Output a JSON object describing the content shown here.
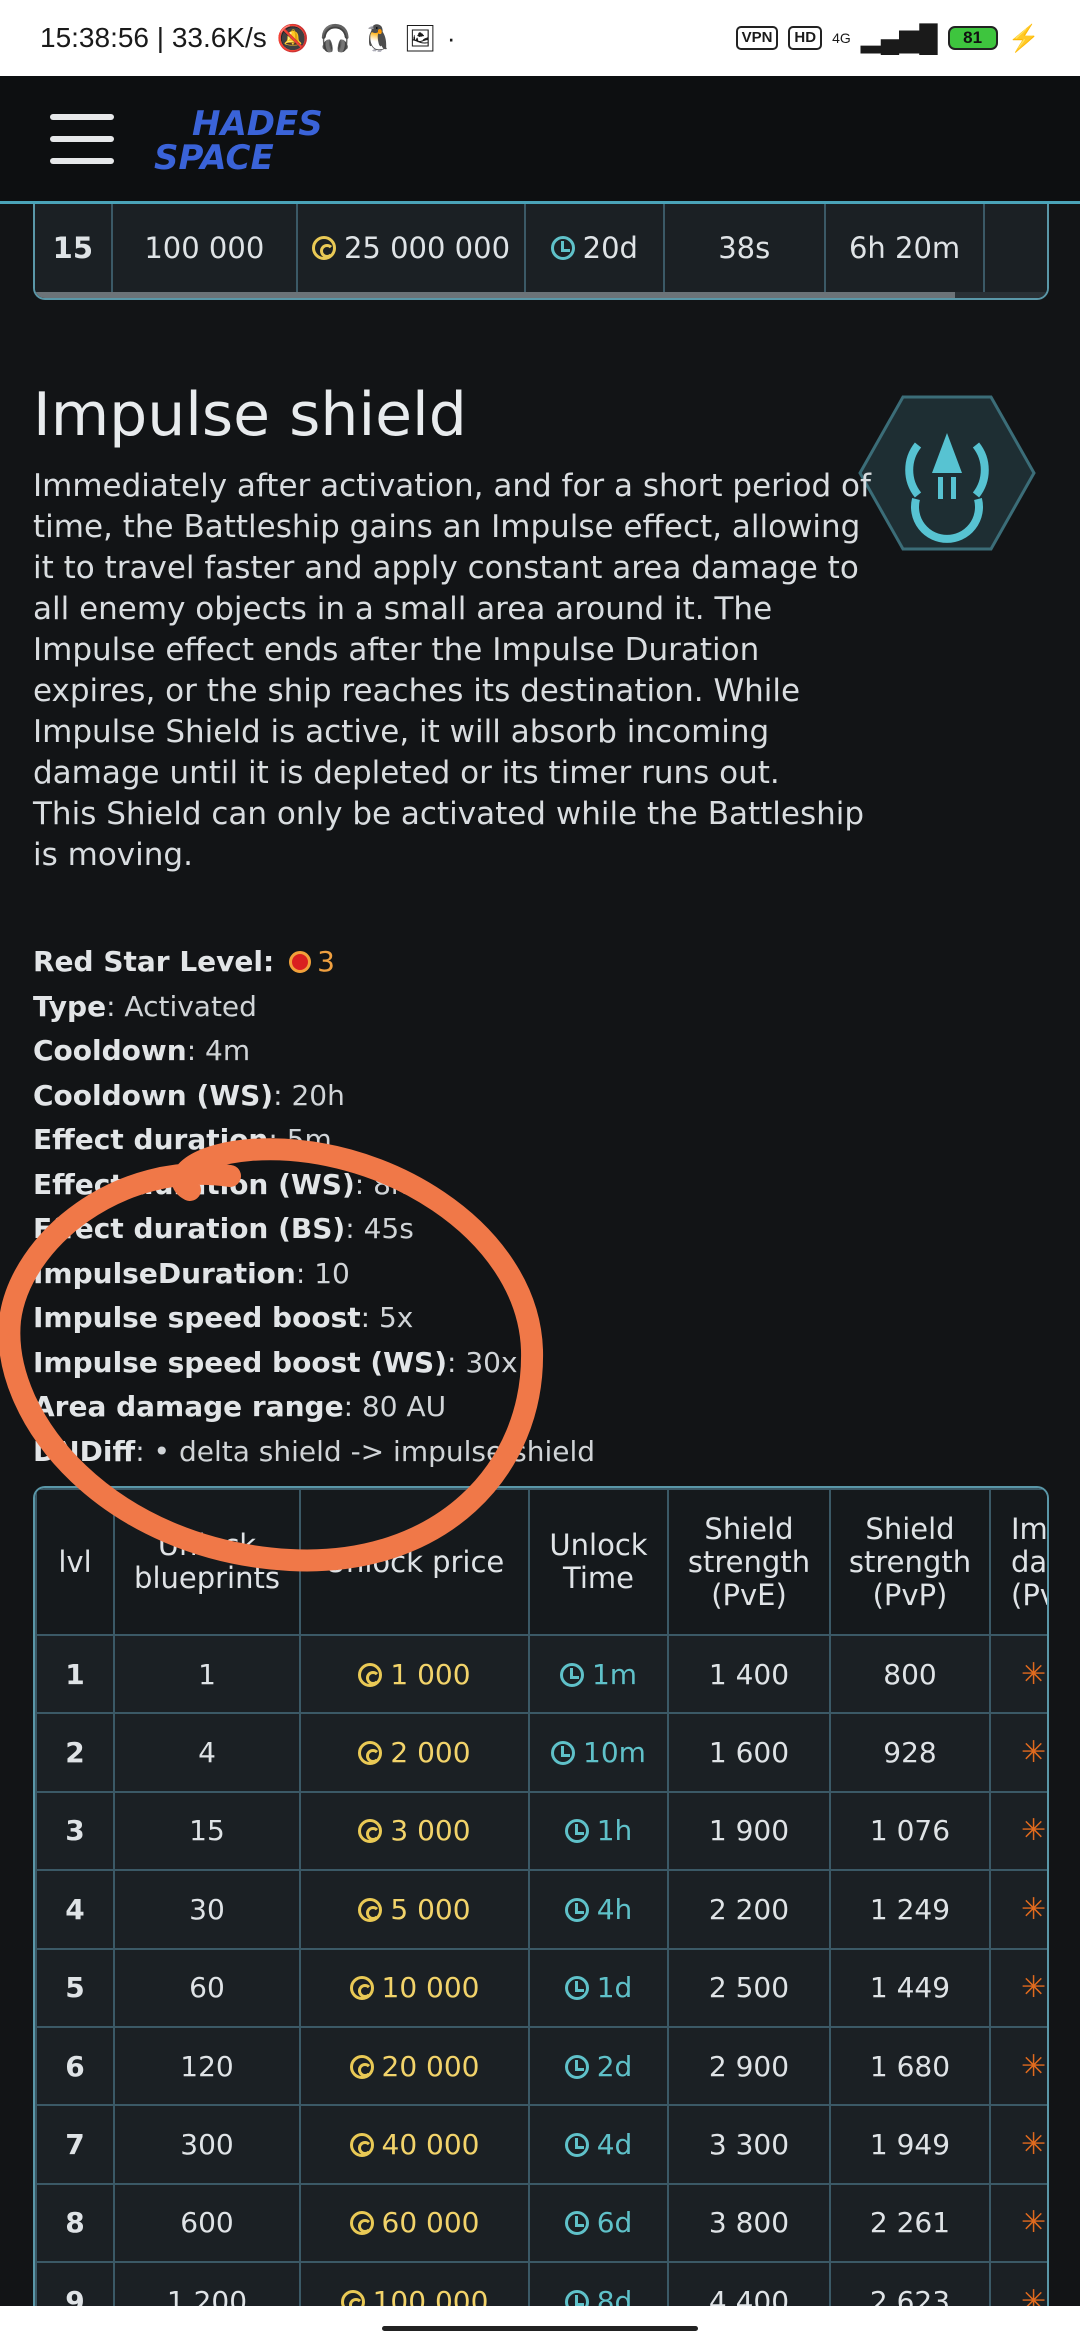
{
  "statusbar": {
    "time_speed": "15:38:56 | 33.6K/s",
    "vpn": "VPN",
    "hd": "HD",
    "net": "4G",
    "battery": "81"
  },
  "nav": {
    "logo_line1": "HADES",
    "logo_line2": "SPACE"
  },
  "top_table_row": {
    "lvl": "15",
    "blueprints": "100 000",
    "price": "25 000 000",
    "time": "20d",
    "c5": "38s",
    "c6": "6h 20m"
  },
  "module": {
    "title": "Impulse shield",
    "description_1": "Immediately after activation, and for a short period of time, the Battleship gains an Impulse effect, allowing it to travel faster and apply constant area damage to all enemy objects in a small area around it. The Impulse effect ends after the Impulse Duration expires, or the ship reaches its destination. While Impulse Shield is active, it will absorb incoming damage until it is depleted or its timer runs out.",
    "description_2": "This Shield can only be activated while the Battleship is moving.",
    "props": [
      {
        "label": "Red Star Level",
        "value": "3"
      },
      {
        "label": "Type",
        "value": "Activated"
      },
      {
        "label": "Cooldown",
        "value": "4m"
      },
      {
        "label": "Cooldown (WS)",
        "value": "20h"
      },
      {
        "label": "Effect duration",
        "value": "5m"
      },
      {
        "label": "Effect duration (WS)",
        "value": "8h"
      },
      {
        "label": "Effect duration (BS)",
        "value": "45s"
      },
      {
        "label": "ImpulseDuration",
        "value": "10"
      },
      {
        "label": "Impulse speed boost",
        "value": "5x"
      },
      {
        "label": "Impulse speed boost (WS)",
        "value": "30x"
      },
      {
        "label": "Area damage range",
        "value": "80 AU"
      },
      {
        "label": "DNDiff",
        "value": "• delta shield -> impulse shield"
      }
    ]
  },
  "table": {
    "headers": [
      "lvl",
      "Unlock blueprints",
      "Unlock price",
      "Unlock Time",
      "Shield strength (PvE)",
      "Shield strength (PvP)",
      "Impulse damage (PvE)"
    ],
    "rows": [
      {
        "lvl": "1",
        "bp": "1",
        "price": "1 000",
        "time": "1m",
        "pve": "1 400",
        "pvp": "800"
      },
      {
        "lvl": "2",
        "bp": "4",
        "price": "2 000",
        "time": "10m",
        "pve": "1 600",
        "pvp": "928"
      },
      {
        "lvl": "3",
        "bp": "15",
        "price": "3 000",
        "time": "1h",
        "pve": "1 900",
        "pvp": "1 076"
      },
      {
        "lvl": "4",
        "bp": "30",
        "price": "5 000",
        "time": "4h",
        "pve": "2 200",
        "pvp": "1 249"
      },
      {
        "lvl": "5",
        "bp": "60",
        "price": "10 000",
        "time": "1d",
        "pve": "2 500",
        "pvp": "1 449"
      },
      {
        "lvl": "6",
        "bp": "120",
        "price": "20 000",
        "time": "2d",
        "pve": "2 900",
        "pvp": "1 680"
      },
      {
        "lvl": "7",
        "bp": "300",
        "price": "40 000",
        "time": "4d",
        "pve": "3 300",
        "pvp": "1 949"
      },
      {
        "lvl": "8",
        "bp": "600",
        "price": "60 000",
        "time": "6d",
        "pve": "3 800",
        "pvp": "2 261"
      },
      {
        "lvl": "9",
        "bp": "1 200",
        "price": "100 000",
        "time": "8d",
        "pve": "4 400",
        "pvp": "2 623"
      }
    ]
  },
  "colors": {
    "accent": "#5fc1c9",
    "price": "#f2d36a",
    "annotation": "#f07848"
  }
}
